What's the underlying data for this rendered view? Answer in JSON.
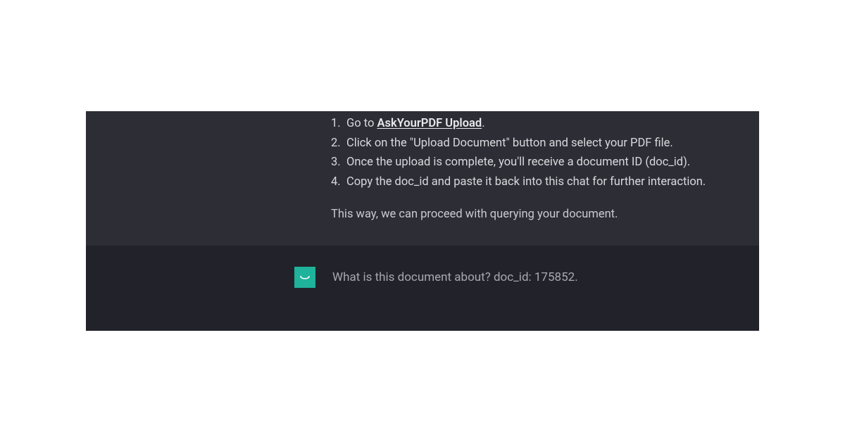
{
  "assistant": {
    "steps": [
      {
        "prefix": "Go to ",
        "link_text": "AskYourPDF Upload",
        "suffix": "."
      },
      {
        "text": "Click on the \"Upload Document\" button and select your PDF file."
      },
      {
        "text": "Once the upload is complete, you'll receive a document ID (doc_id)."
      },
      {
        "text": "Copy the doc_id and paste it back into this chat for further interaction."
      }
    ],
    "closing": "This way, we can proceed with querying your document."
  },
  "user": {
    "message": "What is this document about? doc_id: 175852."
  }
}
